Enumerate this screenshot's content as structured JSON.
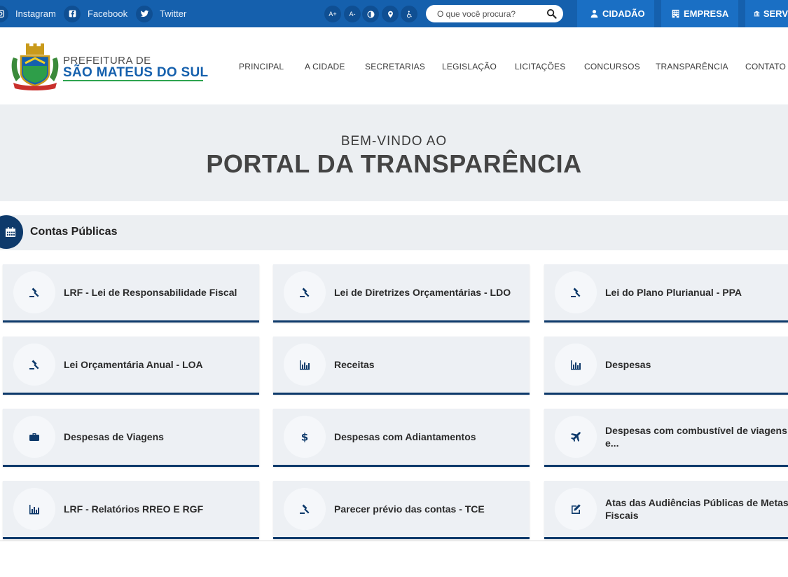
{
  "topbar": {
    "social": [
      {
        "label": "Instagram",
        "icon": "instagram-icon"
      },
      {
        "label": "Facebook",
        "icon": "facebook-icon"
      },
      {
        "label": "Twitter",
        "icon": "twitter-icon"
      }
    ],
    "accessibility": {
      "increase_font": "A+",
      "decrease_font": "A-"
    },
    "search": {
      "placeholder": "O que você procura?"
    },
    "tabs": [
      {
        "label": "CIDADÃO",
        "icon": "user-icon"
      },
      {
        "label": "EMPRESA",
        "icon": "building-icon"
      },
      {
        "label": "SERV",
        "icon": "institution-icon"
      }
    ],
    "color": "#1560ad"
  },
  "brand": {
    "top": "PREFEITURA DE",
    "main": "SÃO MATEUS DO SUL"
  },
  "nav": [
    "PRINCIPAL",
    "A CIDADE",
    "SECRETARIAS",
    "LEGISLAÇÃO",
    "LICITAÇÕES",
    "CONCURSOS",
    "TRANSPARÊNCIA",
    "CONTATO"
  ],
  "hero": {
    "subtitle": "BEM-VINDO AO",
    "title": "PORTAL DA TRANSPARÊNCIA"
  },
  "section": {
    "title": "Contas Públicas",
    "icon": "calendar-icon",
    "color": "#0e3a6b"
  },
  "cards": [
    {
      "label": "LRF - Lei de Responsabilidade Fiscal",
      "icon": "gavel-icon"
    },
    {
      "label": "Lei de Diretrizes Orçamentárias - LDO",
      "icon": "gavel-icon"
    },
    {
      "label": "Lei do Plano Plurianual - PPA",
      "icon": "gavel-icon"
    },
    {
      "label": "Lei Orçamentária Anual - LOA",
      "icon": "gavel-icon"
    },
    {
      "label": "Receitas",
      "icon": "bar-chart-icon"
    },
    {
      "label": "Despesas",
      "icon": "bar-chart-icon"
    },
    {
      "label": "Despesas de Viagens",
      "icon": "briefcase-icon"
    },
    {
      "label": "Despesas com Adiantamentos",
      "icon": "dollar-icon"
    },
    {
      "label": "Despesas com combustível de viagens e...",
      "icon": "plane-icon"
    },
    {
      "label": "LRF - Relatórios RREO E RGF",
      "icon": "bar-chart-icon"
    },
    {
      "label": "Parecer prévio das contas - TCE",
      "icon": "gavel-icon"
    },
    {
      "label": "Atas das Audiências Públicas de Metas Fiscais",
      "icon": "edit-icon"
    }
  ]
}
